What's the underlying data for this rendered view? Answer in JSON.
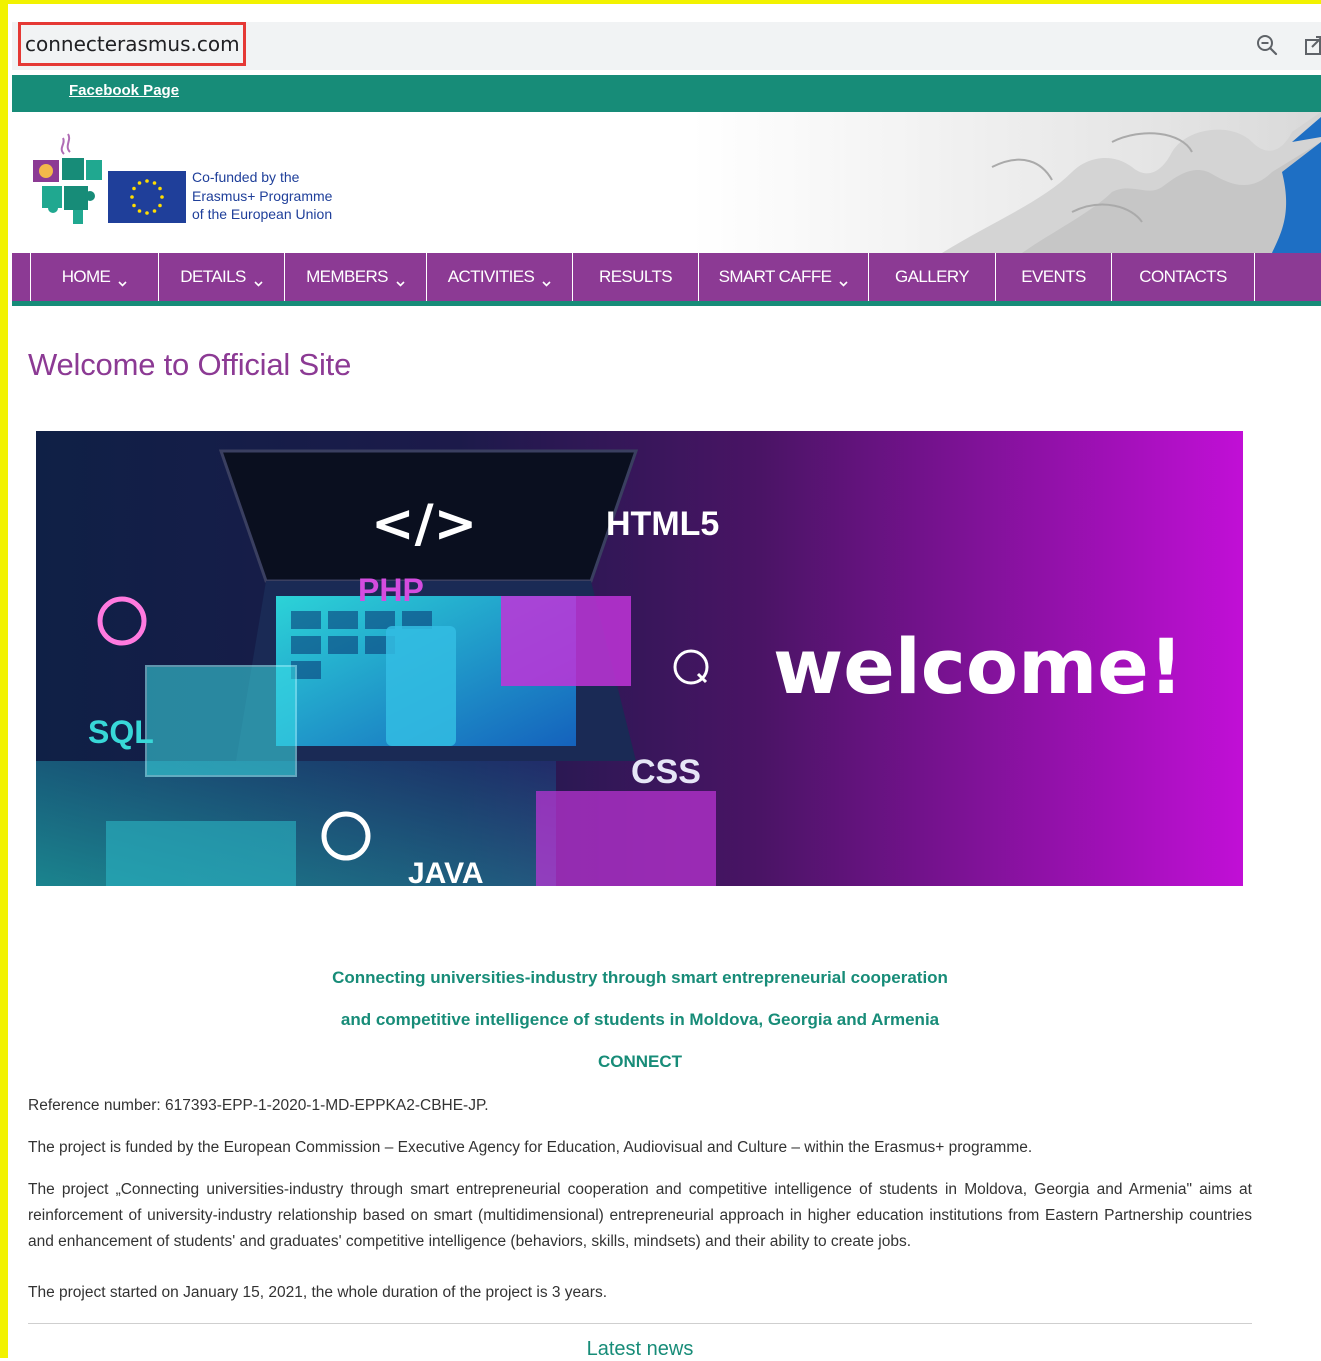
{
  "browser": {
    "url": "connecterasmus.com",
    "zoom_icon": "zoom-out-icon",
    "share_icon": "share-icon"
  },
  "topbar": {
    "facebook_link": "Facebook Page"
  },
  "header": {
    "eu_line1": "Co-funded by the",
    "eu_line2": "Erasmus+ Programme",
    "eu_line3": "of the European Union"
  },
  "nav": {
    "items": [
      {
        "label": "HOME",
        "dropdown": true
      },
      {
        "label": "DETAILS",
        "dropdown": true
      },
      {
        "label": "MEMBERS",
        "dropdown": true
      },
      {
        "label": "ACTIVITIES",
        "dropdown": true
      },
      {
        "label": "RESULTS",
        "dropdown": false
      },
      {
        "label": "SMART CAFFE",
        "dropdown": true
      },
      {
        "label": "GALLERY",
        "dropdown": false
      },
      {
        "label": "EVENTS",
        "dropdown": false
      },
      {
        "label": "CONTACTS",
        "dropdown": false
      }
    ]
  },
  "main": {
    "title": "Welcome to Official Site",
    "banner": {
      "code_tag": "</>",
      "html5": "HTML5",
      "php": "PHP",
      "sql": "SQL",
      "css": "CSS",
      "java": "JAVA",
      "welcome": "welcome!"
    },
    "tagline1": "Connecting universities-industry through smart entrepreneurial cooperation",
    "tagline2": "and competitive intelligence of students in Moldova, Georgia and Armenia",
    "acronym": "CONNECT",
    "reference": "Reference number: 617393-EPP-1-2020-1-MD-EPPKA2-CBHE-JP.",
    "funded": "The project is funded by the European Commission – Executive Agency for Education, Audiovisual and Culture – within the Erasmus+ programme.",
    "description": "The project „Connecting universities-industry through smart entrepreneurial cooperation and competitive intelligence of students in Moldova, Georgia and Armenia\" aims at reinforcement of university-industry relationship based on smart (multidimensional) entrepreneurial approach in higher education institutions from Eastern Partnership countries and enhancement of students' and graduates' competitive intelligence (behaviors, skills, mindsets) and their ability to create jobs.",
    "started": "The project started on January 15, 2021, the whole duration of the project is 3 years.",
    "latest_news": "Latest news"
  },
  "colors": {
    "green": "#178c78",
    "purple": "#8c3a94",
    "eu_blue": "#1f3f9a",
    "highlight_red": "#e53935",
    "frame_yellow": "#f2f200"
  }
}
